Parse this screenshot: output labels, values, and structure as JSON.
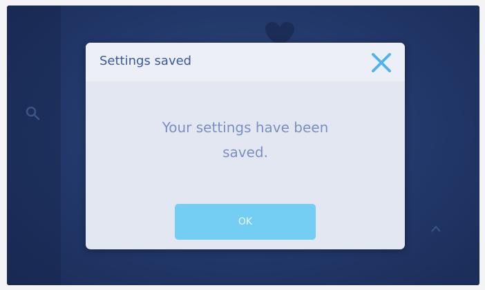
{
  "dialog": {
    "title": "Settings saved",
    "message_line1": "Your settings have been",
    "message_line2": "saved.",
    "ok_label": "OK",
    "close_icon": "close-icon"
  },
  "background": {
    "icons": [
      "heart-icon",
      "search-icon",
      "chevron-icon"
    ]
  },
  "colors": {
    "screen_background": "#22386a",
    "dialog_background": "#e2e7f1",
    "title_text": "#3a5aa0",
    "close_icon": "#4fb3ea",
    "message_text": "#7b8fc2",
    "ok_button": "#74cdf3",
    "ok_button_text": "#eaf7fd"
  }
}
